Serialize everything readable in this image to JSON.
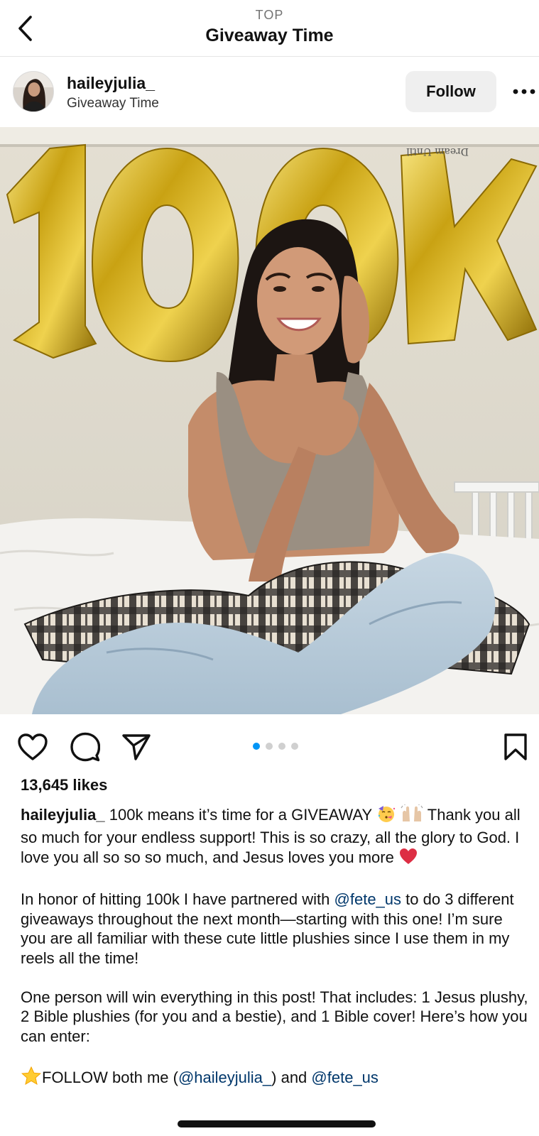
{
  "nav": {
    "kicker": "TOP",
    "title": "Giveaway Time"
  },
  "post": {
    "username": "haileyjulia_",
    "subtitle": "Giveaway Time",
    "follow_label": "Follow",
    "likes": "13,645 likes",
    "carousel": {
      "count": 4,
      "active_index": 0
    },
    "caption": {
      "username": "haileyjulia_",
      "p1_a": "100k means it’s time for a GIVEAWAY",
      "p1_b": "Thank you all so much for your endless support! This is so crazy, all the glory to God. I love you all so so so much, and Jesus loves you more",
      "p2_a": "In honor of hitting 100k I have partnered with",
      "p2_mention": "@fete_us",
      "p2_b": "to do 3 different giveaways throughout the next month—starting with this one! I’m sure you are all familiar with these cute little plushies since I use them in my reels all the time!",
      "p3": "One person will win everything in this post! That includes: 1 Jesus plushy, 2 Bible plushies (for you and a bestie), and 1 Bible cover! Here’s how you can enter:",
      "p4_a": "FOLLOW both me (",
      "p4_mention1": "@haileyjulia_",
      "p4_b": ") and",
      "p4_mention2": "@fete_us"
    }
  },
  "colors": {
    "accent_blue": "#0095f6",
    "mention_blue": "#00376b",
    "button_bg": "#efefef"
  },
  "icons": [
    "back-chevron-icon",
    "more-icon",
    "heart-icon",
    "comment-icon",
    "share-icon",
    "bookmark-icon",
    "party-face-emoji",
    "raised-hands-emoji",
    "red-heart-emoji",
    "star-emoji"
  ]
}
